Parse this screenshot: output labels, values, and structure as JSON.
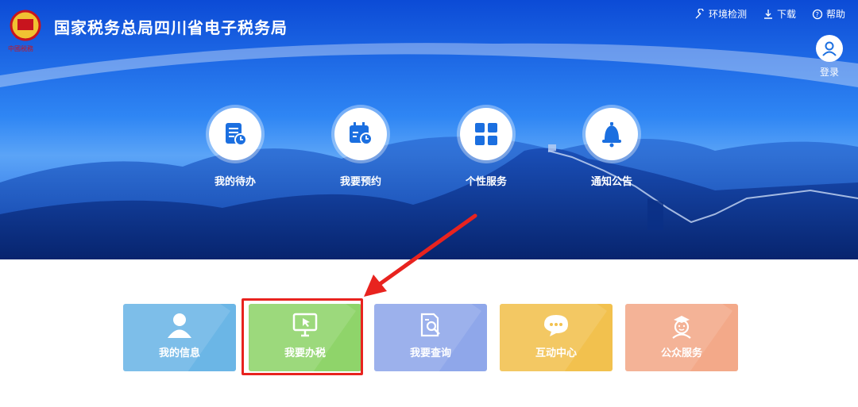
{
  "header": {
    "title": "国家税务总局四川省电子税务局",
    "logo_text": "中國税務",
    "links": [
      {
        "label": "环境检测",
        "icon": "wrench-icon"
      },
      {
        "label": "下载",
        "icon": "download-icon"
      },
      {
        "label": "帮助",
        "icon": "help-icon"
      }
    ],
    "login_label": "登录"
  },
  "quick_nav": [
    {
      "label": "我的待办",
      "icon": "todo-icon"
    },
    {
      "label": "我要预约",
      "icon": "calendar-icon"
    },
    {
      "label": "个性服务",
      "icon": "grid-icon"
    },
    {
      "label": "通知公告",
      "icon": "bell-icon"
    }
  ],
  "cards": [
    {
      "label": "我的信息",
      "icon": "user-icon",
      "color": "#6bb6e6"
    },
    {
      "label": "我要办税",
      "icon": "monitor-icon",
      "color": "#8fd46a"
    },
    {
      "label": "我要查询",
      "icon": "search-doc-icon",
      "color": "#8fa7ea"
    },
    {
      "label": "互动中心",
      "icon": "chat-icon",
      "color": "#f2c14e"
    },
    {
      "label": "公众服务",
      "icon": "person-service-icon",
      "color": "#f3a989"
    }
  ],
  "colors": {
    "accent": "#1f6ff0",
    "highlight": "#e8231f",
    "icon_blue": "#1b6fe0"
  }
}
